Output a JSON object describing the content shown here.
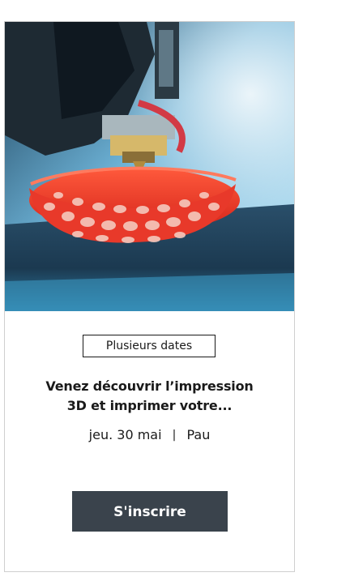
{
  "event": {
    "image_subject": "3D printer nozzle printing red lattice bowl",
    "badge": "Plusieurs dates",
    "title_line1": "Venez découvrir l’impression",
    "title_line2": "3D et imprimer votre...",
    "date": "jeu. 30 mai",
    "separator": "|",
    "location": "Pau",
    "cta_label": "S'inscrire"
  },
  "colors": {
    "cta_background": "#3a434c",
    "text": "#1a1a1a",
    "border": "#cfcfcf",
    "print_red": "#e8392a"
  }
}
